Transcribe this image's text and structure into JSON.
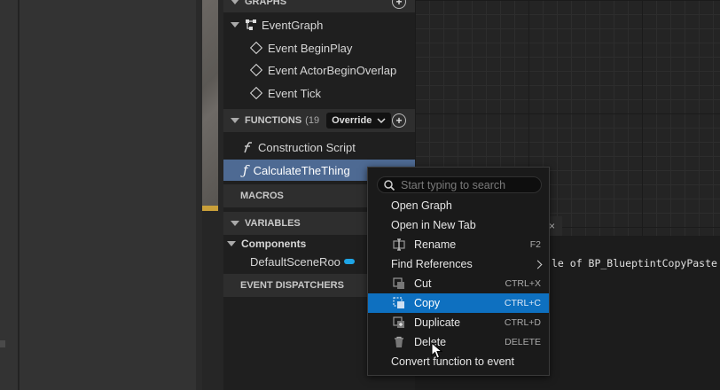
{
  "my_blueprint": {
    "graphs_header": "GRAPHS",
    "event_graph": "EventGraph",
    "events": [
      "Event BeginPlay",
      "Event ActorBeginOverlap",
      "Event Tick"
    ],
    "functions_header": "FUNCTIONS",
    "functions_count": "(19",
    "override_label": "Override",
    "functions": [
      "Construction Script",
      "CalculateTheThing"
    ],
    "macros_header": "MACROS",
    "variables_header": "VARIABLES",
    "components_label": "Components",
    "component_item": "DefaultSceneRoo",
    "event_dispatchers_header": "EVENT DISPATCHERS"
  },
  "context_menu": {
    "search_placeholder": "Start typing to search",
    "items": [
      {
        "label": "Open Graph",
        "shortcut": "",
        "icon": ""
      },
      {
        "label": "Open in New Tab",
        "shortcut": "",
        "icon": ""
      },
      {
        "label": "Rename",
        "shortcut": "F2",
        "icon": "rename-icon"
      },
      {
        "label": "Find References",
        "shortcut": "",
        "icon": "",
        "submenu": true
      },
      {
        "label": "Cut",
        "shortcut": "CTRL+X",
        "icon": "cut-icon"
      },
      {
        "label": "Copy",
        "shortcut": "CTRL+C",
        "icon": "copy-icon"
      },
      {
        "label": "Duplicate",
        "shortcut": "CTRL+D",
        "icon": "duplicate-icon"
      },
      {
        "label": "Delete",
        "shortcut": "DELETE",
        "icon": "trash-icon"
      },
      {
        "label": "Convert function to event",
        "shortcut": "",
        "icon": ""
      }
    ]
  },
  "log": {
    "text": "le of BP_BlueptintCopyPaste"
  },
  "colors": {
    "selection": "#4e6a93",
    "menu_highlight": "#0e70c0",
    "component_pill": "#1ea5e6"
  }
}
